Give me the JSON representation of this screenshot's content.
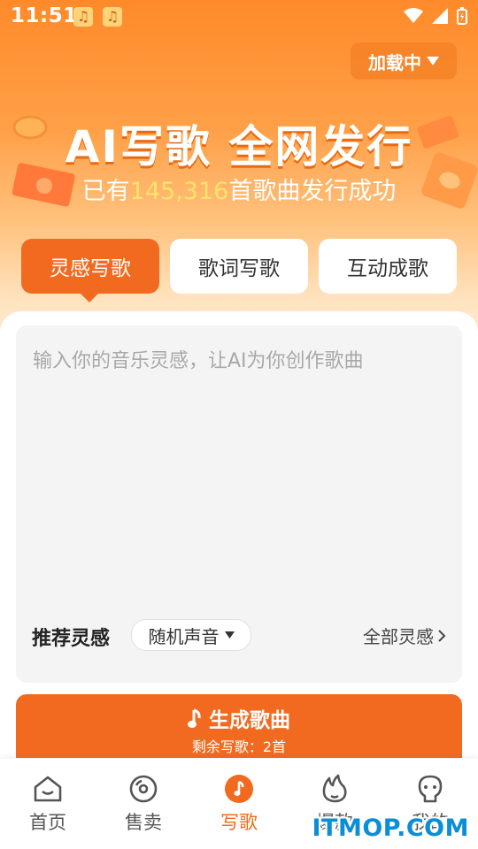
{
  "status": {
    "time": "11:51"
  },
  "header": {
    "loading_label": "加载中"
  },
  "hero": {
    "title": "AI写歌 全网发行",
    "sub_prefix": "已有",
    "sub_count": "145,316",
    "sub_suffix": "首歌曲发行成功"
  },
  "tabs": [
    {
      "label": "灵感写歌",
      "active": true
    },
    {
      "label": "歌词写歌",
      "active": false
    },
    {
      "label": "互动成歌",
      "active": false
    }
  ],
  "input": {
    "placeholder": "输入你的音乐灵感，让AI为你创作歌曲"
  },
  "recommend": {
    "title": "推荐灵感",
    "selected": "随机声音",
    "all_link": "全部灵感"
  },
  "generate": {
    "label": "生成歌曲",
    "remaining": "剩余写歌：2首"
  },
  "nav": {
    "items": [
      {
        "label": "首页",
        "icon": "home-icon"
      },
      {
        "label": "售卖",
        "icon": "disc-icon"
      },
      {
        "label": "写歌",
        "icon": "music-note-icon",
        "active": true
      },
      {
        "label": "爆款",
        "icon": "fire-icon"
      },
      {
        "label": "我的",
        "icon": "user-icon"
      }
    ]
  },
  "watermark": "ITMOP.COM",
  "colors": {
    "accent": "#f26a20",
    "count_highlight": "#ffe36a"
  }
}
